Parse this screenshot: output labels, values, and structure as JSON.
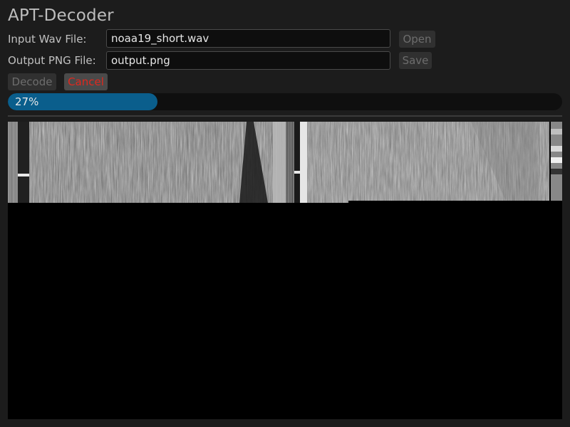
{
  "app": {
    "title": "APT-Decoder"
  },
  "input": {
    "label": "Input Wav File:",
    "value": "noaa19_short.wav",
    "button": "Open"
  },
  "output": {
    "label": "Output PNG File:",
    "value": "output.png",
    "button": "Save"
  },
  "actions": {
    "decode_label": "Decode",
    "cancel_label": "Cancel"
  },
  "progress": {
    "percent": 27,
    "text": "27%"
  },
  "colors": {
    "accent": "#0a5e8c",
    "cancel": "#e0281e",
    "background": "#1c1c1c"
  }
}
